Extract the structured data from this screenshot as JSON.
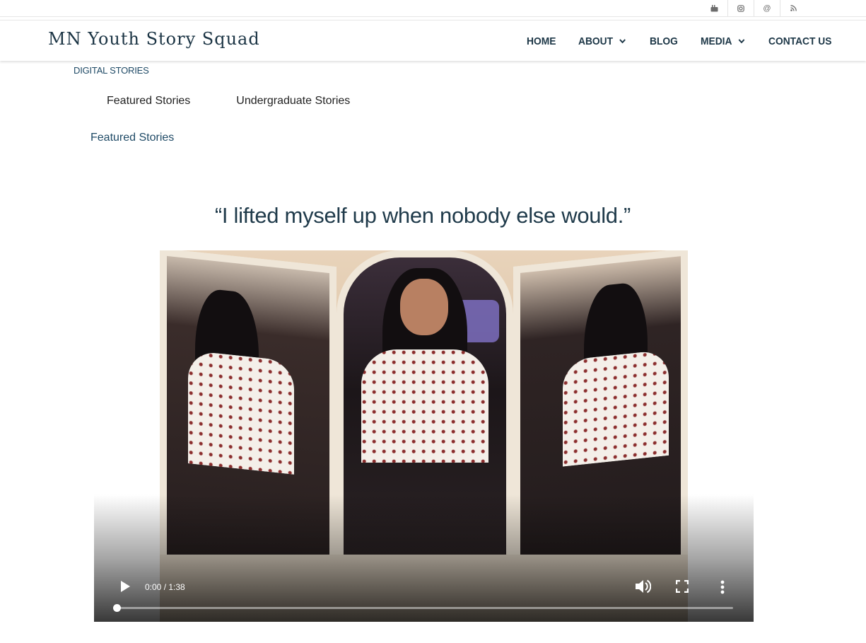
{
  "social": {
    "icons": [
      "youtube-icon",
      "instagram-icon",
      "email-icon",
      "rss-icon"
    ],
    "glyphs": [
      "▶",
      "◎",
      "@",
      "⚇"
    ]
  },
  "header": {
    "brand": "MN Youth Story Squad",
    "nav": [
      {
        "label": "HOME",
        "has_dropdown": false
      },
      {
        "label": "ABOUT",
        "has_dropdown": true
      },
      {
        "label": "BLOG",
        "has_dropdown": false
      },
      {
        "label": "MEDIA",
        "has_dropdown": true
      },
      {
        "label": "CONTACT US",
        "has_dropdown": false
      }
    ]
  },
  "section": {
    "label": "DIGITAL STORIES",
    "tabs": [
      "Featured Stories",
      "Undergraduate Stories"
    ],
    "current_title": "Featured Stories"
  },
  "story": {
    "quote": "“I lifted myself up when nobody else would.”"
  },
  "video": {
    "time": "0:00 / 1:38",
    "progress": 0,
    "controls": [
      "play-icon",
      "volume-icon",
      "fullscreen-icon",
      "more-options-icon"
    ]
  },
  "colors": {
    "brand_text": "#1b3444",
    "accent": "#1f4a66",
    "nav_text": "#1d3747"
  }
}
